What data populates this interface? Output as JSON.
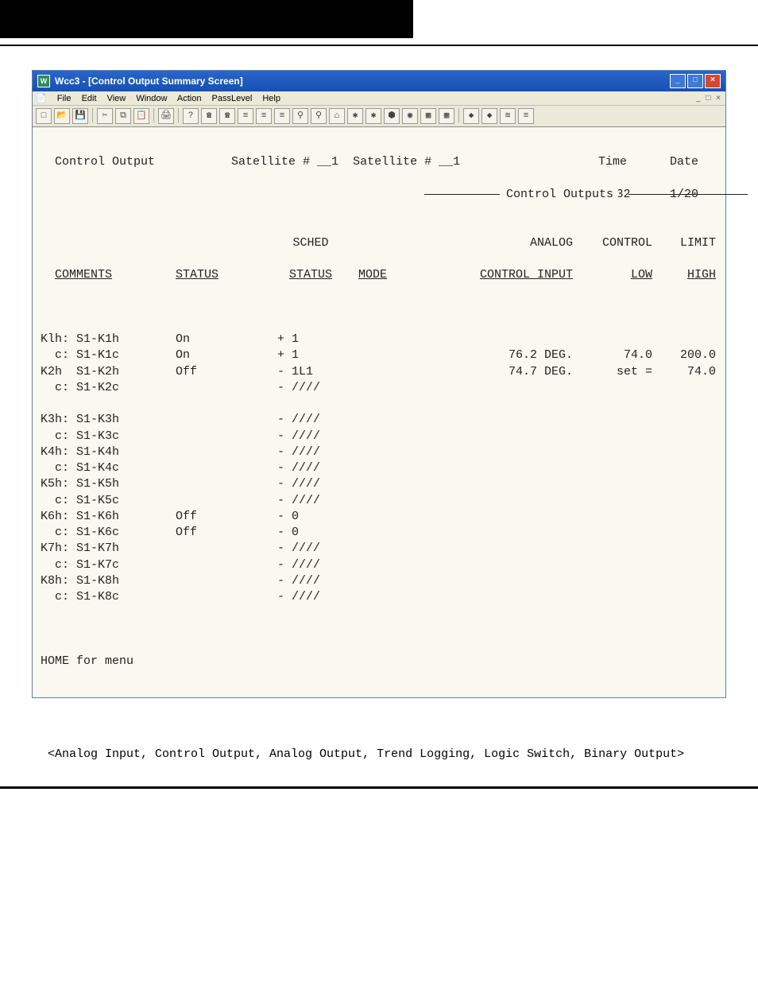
{
  "window": {
    "title": "Wcc3 - [Control Output Summary Screen]",
    "menus": [
      "File",
      "Edit",
      "View",
      "Window",
      "Action",
      "PassLevel",
      "Help"
    ]
  },
  "header": {
    "left_label": "Control Output",
    "sat_label_1": "Satellite #",
    "sat_val_1": "1",
    "sat_label_2": "Satellite #",
    "sat_val_2": "1",
    "control_outputs_label": "Control Outputs",
    "time_label": "Time",
    "time_value": "08:32",
    "date_label": "Date",
    "date_value": "1/20"
  },
  "columns": {
    "comments": "COMMENTS",
    "status": "STATUS",
    "sched": "SCHED",
    "sched2": "STATUS",
    "mode": "MODE",
    "analog1": "ANALOG",
    "analog2": "CONTROL INPUT",
    "control": "CONTROL",
    "control2": "LOW",
    "limit": "LIMIT",
    "limit2": "HIGH"
  },
  "rows": [
    {
      "comment": "Klh: S1-K1h",
      "status": "On",
      "sched": "+ 1",
      "mode": "",
      "analog": "",
      "control": "",
      "limit": ""
    },
    {
      "comment": "  c: S1-K1c",
      "status": "On",
      "sched": "+ 1",
      "mode": "",
      "analog": "76.2 DEG.",
      "control": "74.0",
      "limit": "200.0"
    },
    {
      "comment": "K2h  S1-K2h",
      "status": "Off",
      "sched": "- 1L1",
      "mode": "",
      "analog": "74.7 DEG.",
      "control": "set =",
      "limit": "74.0"
    },
    {
      "comment": "  c: S1-K2c",
      "status": "",
      "sched": "- ////",
      "mode": "",
      "analog": "",
      "control": "",
      "limit": ""
    },
    {
      "comment": "",
      "status": "",
      "sched": "",
      "mode": "",
      "analog": "",
      "control": "",
      "limit": ""
    },
    {
      "comment": "K3h: S1-K3h",
      "status": "",
      "sched": "- ////",
      "mode": "",
      "analog": "",
      "control": "",
      "limit": ""
    },
    {
      "comment": "  c: S1-K3c",
      "status": "",
      "sched": "- ////",
      "mode": "",
      "analog": "",
      "control": "",
      "limit": ""
    },
    {
      "comment": "K4h: S1-K4h",
      "status": "",
      "sched": "- ////",
      "mode": "",
      "analog": "",
      "control": "",
      "limit": ""
    },
    {
      "comment": "  c: S1-K4c",
      "status": "",
      "sched": "- ////",
      "mode": "",
      "analog": "",
      "control": "",
      "limit": ""
    },
    {
      "comment": "K5h: S1-K5h",
      "status": "",
      "sched": "- ////",
      "mode": "",
      "analog": "",
      "control": "",
      "limit": ""
    },
    {
      "comment": "  c: S1-K5c",
      "status": "",
      "sched": "- ////",
      "mode": "",
      "analog": "",
      "control": "",
      "limit": ""
    },
    {
      "comment": "K6h: S1-K6h",
      "status": "Off",
      "sched": "- 0",
      "mode": "",
      "analog": "",
      "control": "",
      "limit": ""
    },
    {
      "comment": "  c: S1-K6c",
      "status": "Off",
      "sched": "- 0",
      "mode": "",
      "analog": "",
      "control": "",
      "limit": ""
    },
    {
      "comment": "K7h: S1-K7h",
      "status": "",
      "sched": "- ////",
      "mode": "",
      "analog": "",
      "control": "",
      "limit": ""
    },
    {
      "comment": "  c: S1-K7c",
      "status": "",
      "sched": "- ////",
      "mode": "",
      "analog": "",
      "control": "",
      "limit": ""
    },
    {
      "comment": "K8h: S1-K8h",
      "status": "",
      "sched": "- ////",
      "mode": "",
      "analog": "",
      "control": "",
      "limit": ""
    },
    {
      "comment": "  c: S1-K8c",
      "status": "",
      "sched": "- ////",
      "mode": "",
      "analog": "",
      "control": "",
      "limit": ""
    }
  ],
  "footer": "HOME for menu",
  "below": {
    "line1": "<Analog Input, Control Output, Analog Output,",
    "line2": " Trend Logging, Logic Switch, Binary Output>"
  }
}
